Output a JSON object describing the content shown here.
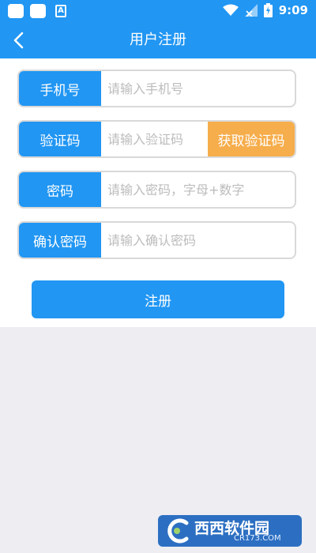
{
  "status_bar": {
    "time": "9:09",
    "notification_glyph": "A"
  },
  "appbar": {
    "title": "用户注册",
    "back_icon": "chevron-left-icon"
  },
  "form": {
    "phone": {
      "label": "手机号",
      "placeholder": "请输入手机号"
    },
    "code": {
      "label": "验证码",
      "placeholder": "请输入验证码",
      "button": "获取验证码"
    },
    "password": {
      "label": "密码",
      "placeholder": "请输入密码，字母+数字"
    },
    "confirm": {
      "label": "确认密码",
      "placeholder": "请输入确认密码"
    },
    "submit": "注册"
  },
  "watermark": {
    "text": "西西软件园",
    "sub": "CR173.COM"
  },
  "colors": {
    "primary": "#2196f3",
    "accent": "#f6ad4b",
    "background": "#ededf2"
  }
}
